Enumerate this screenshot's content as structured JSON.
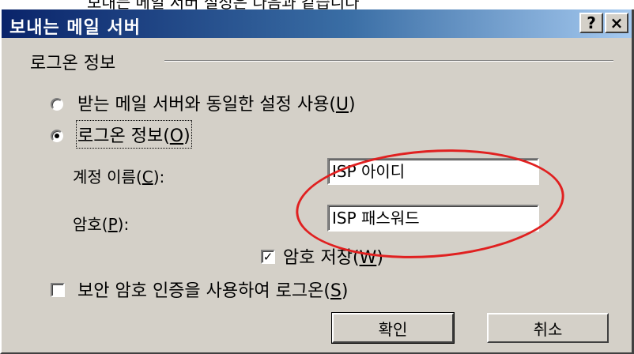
{
  "page_caption_fragment": "보내는 메일 서버 설정은 다음과 같습니다",
  "dialog": {
    "title": "보내는 메일 서버",
    "help_label": "?",
    "close_label": "×"
  },
  "group": {
    "label": "로그온 정보"
  },
  "options": {
    "same_settings_label": "받는 메일 서버와 동일한 설정 사용(",
    "same_settings_key": "U",
    "logon_info_label": "로그온 정보(",
    "logon_info_key": "O",
    "selected": "logon_info"
  },
  "account": {
    "label": "계정 이름(",
    "key": "C",
    "suffix": "):",
    "value": "ISP 아이디"
  },
  "password": {
    "label": "암호(",
    "key": "P",
    "suffix": "):",
    "value": "ISP 패스워드"
  },
  "remember_password": {
    "label": "암호 저장(",
    "key": "W",
    "checked": true,
    "check_glyph": "✓"
  },
  "spa": {
    "label": "보안 암호 인증을 사용하여 로그온(",
    "key": "S",
    "checked": false
  },
  "buttons": {
    "ok": "확인",
    "cancel": "취소"
  },
  "colors": {
    "annotation": "#e02020",
    "titlebar_start": "#0a246a",
    "titlebar_end": "#a6caf0",
    "face": "#d4d0c8"
  }
}
